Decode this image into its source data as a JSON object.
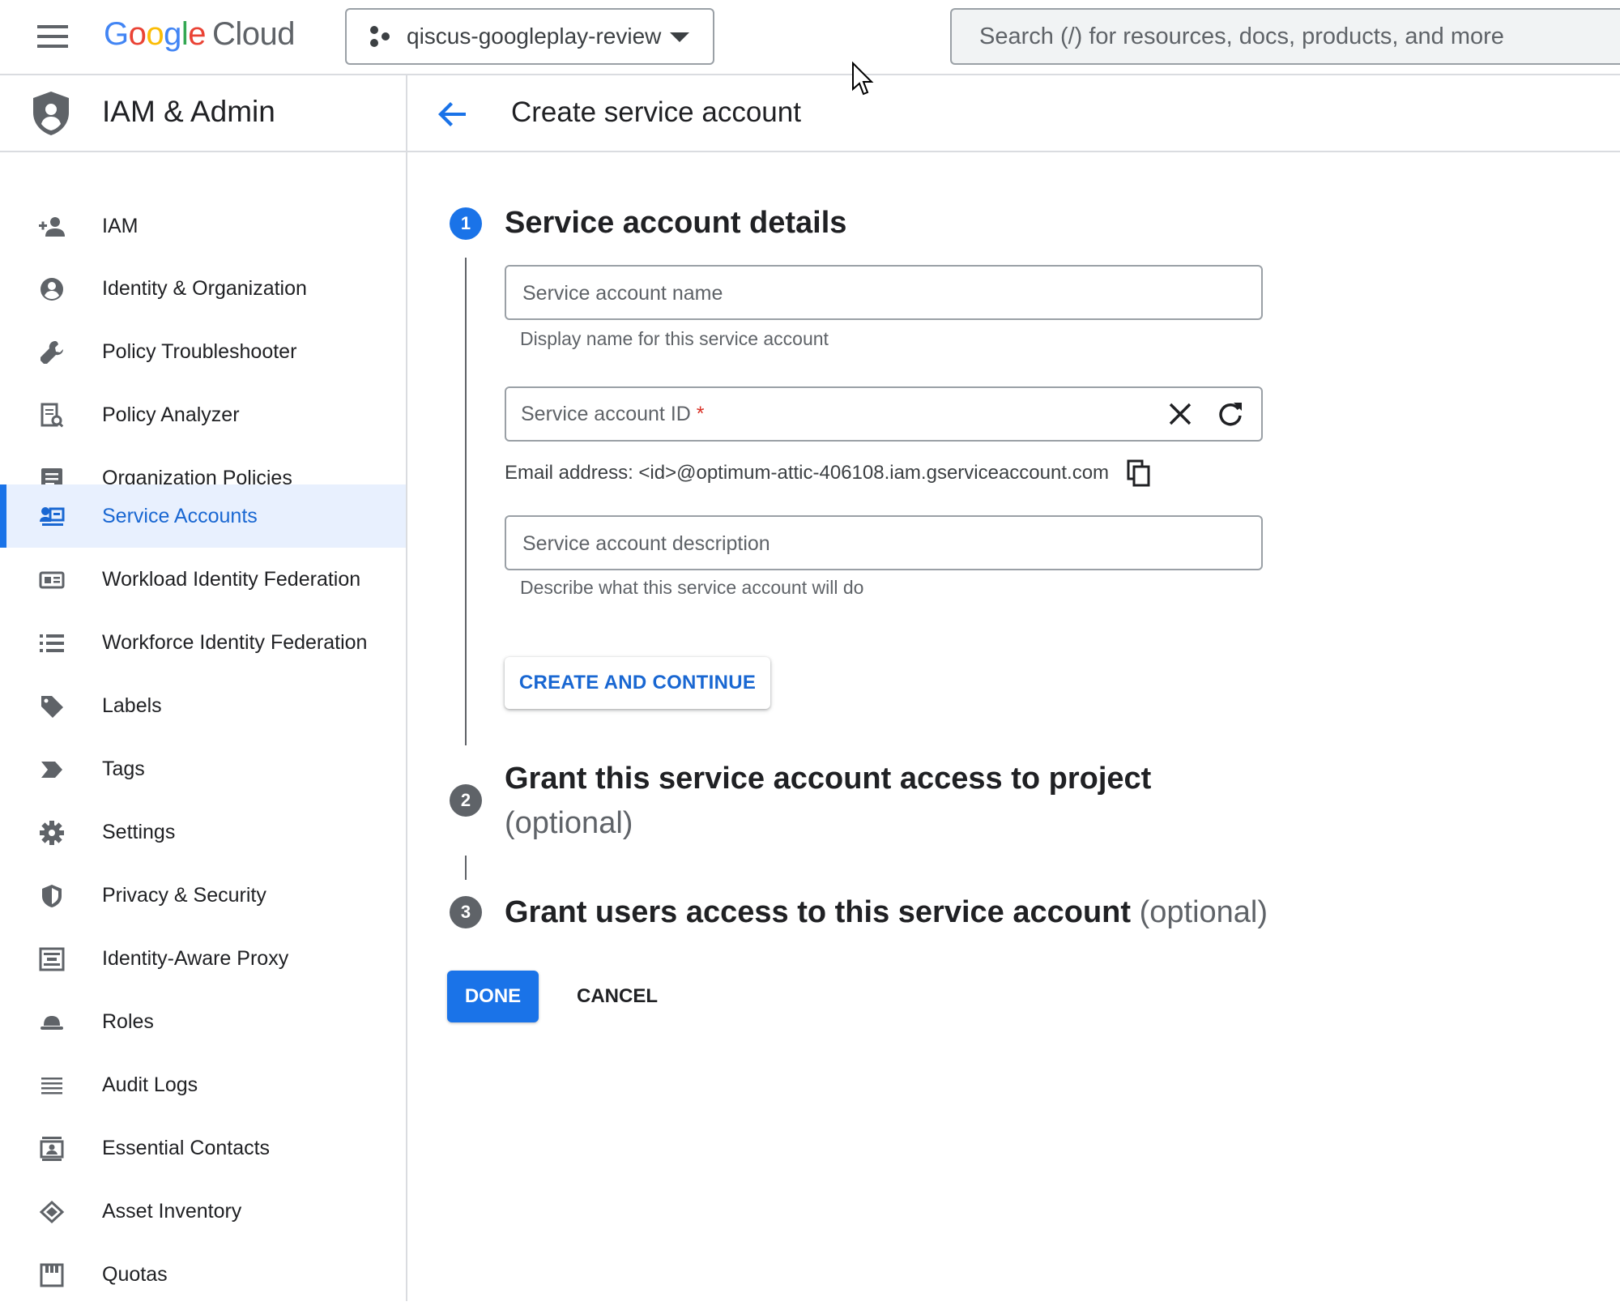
{
  "header": {
    "logo_google": "Google",
    "logo_cloud": "Cloud",
    "project_name": "qiscus-googleplay-review",
    "search_placeholder": "Search (/) for resources, docs, products, and more"
  },
  "sidebar": {
    "title": "IAM & Admin",
    "items": [
      {
        "label": "IAM",
        "icon": "person-add-icon"
      },
      {
        "label": "Identity & Organization",
        "icon": "account-circle-icon"
      },
      {
        "label": "Policy Troubleshooter",
        "icon": "wrench-icon"
      },
      {
        "label": "Policy Analyzer",
        "icon": "document-search-icon"
      },
      {
        "label": "Organization Policies",
        "icon": "article-icon"
      },
      {
        "label": "Service Accounts",
        "icon": "service-account-icon",
        "active": true
      },
      {
        "label": "Workload Identity Federation",
        "icon": "id-card-icon"
      },
      {
        "label": "Workforce Identity Federation",
        "icon": "list-icon"
      },
      {
        "label": "Labels",
        "icon": "label-tag-icon"
      },
      {
        "label": "Tags",
        "icon": "tag-arrow-icon"
      },
      {
        "label": "Settings",
        "icon": "gear-icon"
      },
      {
        "label": "Privacy & Security",
        "icon": "shield-icon"
      },
      {
        "label": "Identity-Aware Proxy",
        "icon": "proxy-icon"
      },
      {
        "label": "Roles",
        "icon": "hat-icon"
      },
      {
        "label": "Audit Logs",
        "icon": "lines-icon"
      },
      {
        "label": "Essential Contacts",
        "icon": "contact-card-icon"
      },
      {
        "label": "Asset Inventory",
        "icon": "layers-icon"
      },
      {
        "label": "Quotas",
        "icon": "quota-icon"
      }
    ]
  },
  "page": {
    "title": "Create service account"
  },
  "steps": {
    "step1": {
      "number": "1",
      "title": "Service account details",
      "name_placeholder": "Service account name",
      "name_hint": "Display name for this service account",
      "id_placeholder": "Service account ID",
      "id_required": "*",
      "email_text": "Email address: <id>@optimum-attic-406108.iam.gserviceaccount.com",
      "description_placeholder": "Service account description",
      "description_hint": "Describe what this service account will do",
      "create_button": "CREATE AND CONTINUE"
    },
    "step2": {
      "number": "2",
      "title_line1": "Grant this service account access to project",
      "optional": "(optional)"
    },
    "step3": {
      "number": "3",
      "title": "Grant users access to this service account",
      "optional": "(optional)"
    }
  },
  "actions": {
    "done": "DONE",
    "cancel": "CANCEL"
  },
  "colors": {
    "accent": "#1a73e8",
    "active_bg": "#e8f0fe",
    "required": "#d93025"
  }
}
